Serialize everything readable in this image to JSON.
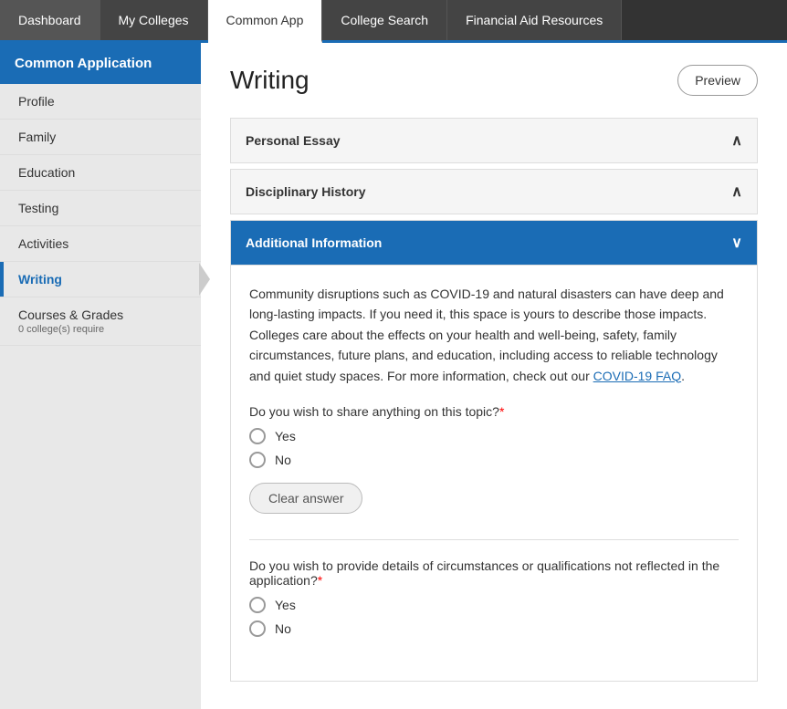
{
  "topNav": {
    "tabs": [
      {
        "id": "dashboard",
        "label": "Dashboard",
        "active": false
      },
      {
        "id": "my-colleges",
        "label": "My Colleges",
        "active": false
      },
      {
        "id": "common-app",
        "label": "Common App",
        "active": true
      },
      {
        "id": "college-search",
        "label": "College Search",
        "active": false
      },
      {
        "id": "financial-aid",
        "label": "Financial Aid Resources",
        "active": false
      }
    ]
  },
  "sidebar": {
    "header": "Common Application",
    "items": [
      {
        "id": "profile",
        "label": "Profile",
        "active": false,
        "sub": ""
      },
      {
        "id": "family",
        "label": "Family",
        "active": false,
        "sub": ""
      },
      {
        "id": "education",
        "label": "Education",
        "active": false,
        "sub": ""
      },
      {
        "id": "testing",
        "label": "Testing",
        "active": false,
        "sub": ""
      },
      {
        "id": "activities",
        "label": "Activities",
        "active": false,
        "sub": ""
      },
      {
        "id": "writing",
        "label": "Writing",
        "active": true,
        "sub": ""
      },
      {
        "id": "courses-grades",
        "label": "Courses & Grades",
        "active": false,
        "sub": "0 college(s) require"
      }
    ]
  },
  "content": {
    "pageTitle": "Writing",
    "previewBtn": "Preview",
    "sections": [
      {
        "id": "personal-essay",
        "title": "Personal Essay",
        "expanded": false,
        "chevron": "∧"
      },
      {
        "id": "disciplinary-history",
        "title": "Disciplinary History",
        "expanded": false,
        "chevron": "∧"
      },
      {
        "id": "additional-info",
        "title": "Additional Information",
        "expanded": true,
        "chevron": "∨",
        "description1": "Community disruptions such as COVID-19 and natural disasters can have deep and long-lasting impacts. If you need it, this space is yours to describe those impacts. Colleges care about the effects on your health and well-being, safety, family circumstances, future plans, and education, including access to reliable technology and quiet study spaces. For more information, check out our ",
        "covidLinkText": "COVID-19 FAQ",
        "description2": ".",
        "questions": [
          {
            "id": "q1",
            "label": "Do you wish to share anything on this topic?",
            "required": true,
            "options": [
              "Yes",
              "No"
            ],
            "clearLabel": "Clear answer"
          },
          {
            "id": "q2",
            "label": "Do you wish to provide details of circumstances or qualifications not reflected in the application?",
            "required": true,
            "options": [
              "Yes",
              "No"
            ]
          }
        ]
      }
    ]
  }
}
